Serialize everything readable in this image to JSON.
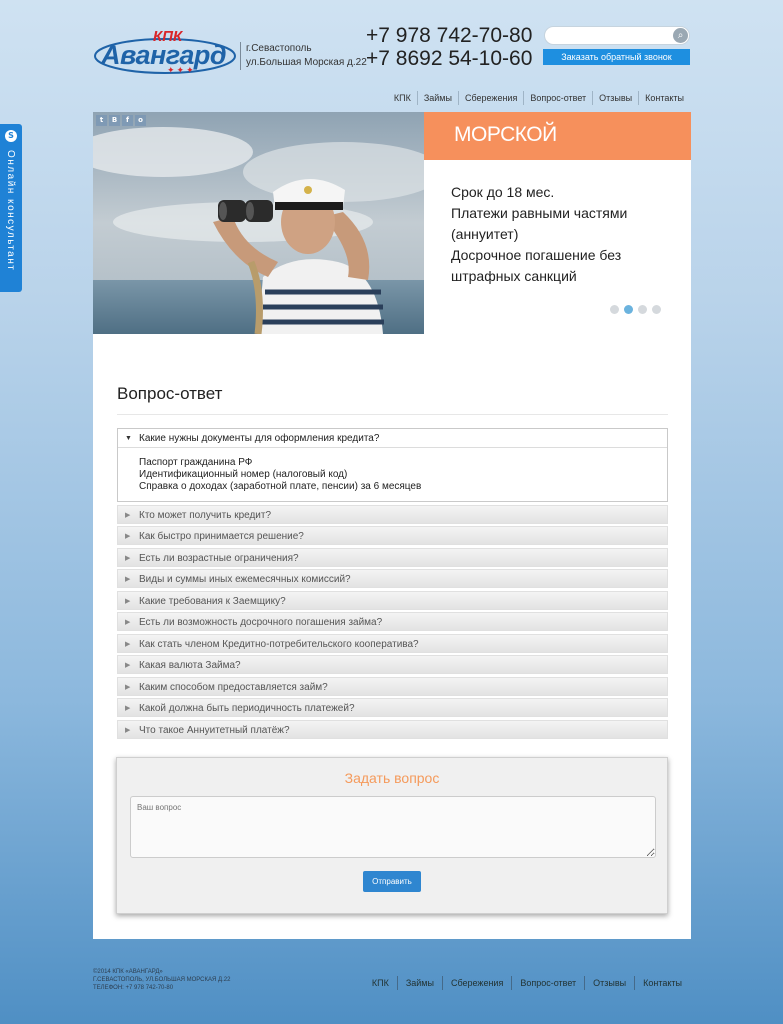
{
  "header": {
    "logo_kpk": "КПК",
    "logo_name": "Авангард",
    "address": [
      "г.Севастополь",
      "ул.Большая Морская д.22"
    ],
    "phones": [
      "+7 978 742-70-80",
      "+7 8692 54-10-60"
    ],
    "search_placeholder": "",
    "callback_label": "Заказать обратный звонок"
  },
  "nav": {
    "items": [
      "КПК",
      "Займы",
      "Сбережения",
      "Вопрос-ответ",
      "Отзывы",
      "Контакты"
    ]
  },
  "side_tab": {
    "label": "Онлайн консультант",
    "icon": "skype-icon"
  },
  "hero": {
    "social_icons": [
      "twitter-icon",
      "vk-icon",
      "facebook-icon",
      "odnoklassniki-icon"
    ],
    "slide_title": "МОРСКОЙ",
    "slide_lines": [
      "Срок до 18 мес.",
      "Платежи равными частями",
      "(аннуитет)",
      "Досрочное погашение без",
      "штрафных санкций"
    ],
    "slider_dot_count": 4,
    "active_slide_index": 1
  },
  "qa": {
    "title": "Вопрос-ответ",
    "open_question": "Какие нужны документы для оформления кредита?",
    "open_answer": [
      "Паспорт гражданина РФ",
      "Идентификационный номер (налоговый код)",
      "Справка о доходах (заработной плате, пенсии) за 6 месяцев"
    ],
    "questions": [
      "Кто может получить кредит?",
      "Как быстро принимается решение?",
      "Есть ли возрастные ограничения?",
      "Виды и суммы иных ежемесячных комиссий?",
      "Какие требования к Заемщику?",
      "Есть ли возможность досрочного погашения займа?",
      "Как стать членом Кредитно-потребительского кооператива?",
      "Какая валюта Займа?",
      "Каким способом предоставляется займ?",
      "Какой должна быть периодичность платежей?",
      "Что такое Аннуитетный платёж?"
    ]
  },
  "ask": {
    "title": "Задать вопрос",
    "placeholder": "Ваш вопрос",
    "submit_label": "Отправить"
  },
  "footer": {
    "info": [
      "©2014 КПК «АВАНГАРД»",
      "Г.СЕВАСТОПОЛЬ, УЛ.БОЛЬШАЯ МОРСКАЯ Д.22",
      "ТЕЛЕФОН: +7 978 742-70-80"
    ],
    "nav": [
      "КПК",
      "Займы",
      "Сбережения",
      "Вопрос-ответ",
      "Отзывы",
      "Контакты"
    ]
  },
  "colors": {
    "accent_blue": "#1e8fe0",
    "slide_orange": "#f6905c",
    "ask_title_orange": "#f59a5b",
    "logo_red": "#d9262b",
    "logo_blue": "#1f63a8"
  }
}
